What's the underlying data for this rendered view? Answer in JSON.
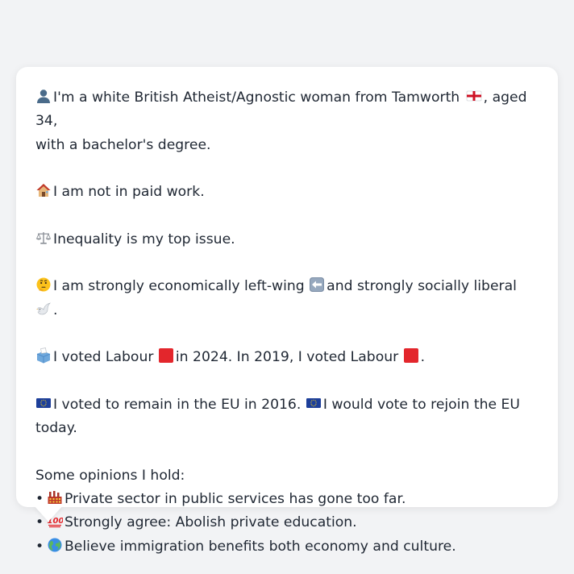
{
  "profile": {
    "line1_a": "I'm a white British Atheist/Agnostic woman from Tamworth",
    "line1_b": ", aged 34,",
    "line1_c": "with a bachelor's degree.",
    "work": "I am not in paid work.",
    "issue": "Inequality is my top issue.",
    "econ_a": "I am strongly economically left-wing",
    "econ_b": "and strongly socially liberal",
    "econ_c": ".",
    "vote_a": "I voted Labour",
    "vote_b": "in 2024. In 2019, I voted Labour",
    "vote_c": ".",
    "eu_a": "I voted to remain in the EU in 2016.",
    "eu_b": "I would vote to rejoin the EU today.",
    "opinions_heading": "Some opinions I hold:",
    "opinions": [
      "Private sector in public services has gone too far.",
      "Strongly agree: Abolish private education.",
      "Believe immigration benefits both economy and culture."
    ],
    "bullet": "•"
  },
  "icons": {
    "person": "person-silhouette-icon",
    "england_flag": "england-flag-icon",
    "house": "house-icon",
    "scales": "balance-scale-icon",
    "thinking": "thinking-face-icon",
    "left_arrow": "left-arrow-icon",
    "dove": "dove-icon",
    "ballot": "ballot-box-icon",
    "labour_square": "red-square-icon",
    "eu_flag": "eu-flag-icon",
    "factory": "factory-icon",
    "hundred": "hundred-points-icon",
    "globe": "globe-icon"
  },
  "colors": {
    "labour_red": "#e3262c",
    "eu_blue": "#1d3f9a",
    "text": "#1f2733",
    "background": "#f2f3f5"
  }
}
